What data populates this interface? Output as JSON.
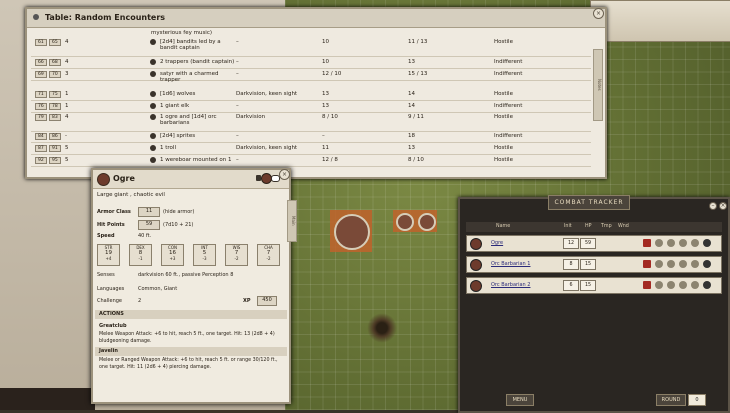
{
  "encounters": {
    "title": "Table: Random Encounters",
    "top_text": "mysterious fey music)",
    "rows": [
      {
        "from": "61",
        "to": "65",
        "count": "4",
        "name": "[2d4] bandits led by a bandit captain",
        "senses": "–",
        "col3": "10",
        "col4": "11 / 13",
        "att": "Hostile"
      },
      {
        "from": "66",
        "to": "68",
        "count": "4",
        "name": "2 trappers (bandit captain)",
        "senses": "–",
        "col3": "10",
        "col4": "13",
        "att": "Indifferent"
      },
      {
        "from": "69",
        "to": "70",
        "count": "3",
        "name": "satyr with a charmed trapper",
        "senses": "–",
        "col3": "12 / 10",
        "col4": "15 / 13",
        "att": "Indifferent"
      },
      {
        "from": "71",
        "to": "75",
        "count": "1",
        "name": "[1d6] wolves",
        "senses": "Darkvision, keen sight",
        "col3": "13",
        "col4": "14",
        "att": "Hostile"
      },
      {
        "from": "76",
        "to": "78",
        "count": "1",
        "name": "1 giant elk",
        "senses": "–",
        "col3": "13",
        "col4": "14",
        "att": "Indifferent"
      },
      {
        "from": "79",
        "to": "83",
        "count": "4",
        "name": "1 ogre and [1d4] orc barbarians",
        "senses": "Darkvision",
        "col3": "8 / 10",
        "col4": "9 / 11",
        "att": "Hostile"
      },
      {
        "from": "84",
        "to": "86",
        "count": "-",
        "name": "[2d4] sprites",
        "senses": "–",
        "col3": "–",
        "col4": "18",
        "att": "Indifferent"
      },
      {
        "from": "87",
        "to": "91",
        "count": "5",
        "name": "1 troll",
        "senses": "Darkvision, keen sight",
        "col3": "11",
        "col4": "13",
        "att": "Hostile"
      },
      {
        "from": "92",
        "to": "95",
        "count": "5",
        "name": "1 wereboar mounted on 1",
        "senses": "–",
        "col3": "12 / 8",
        "col4": "8 / 10",
        "att": "Hostile"
      }
    ],
    "side_tab": "Notes"
  },
  "ogre": {
    "name": "Ogre",
    "type": "Large giant , chaotic evil",
    "ac_label": "Armor Class",
    "ac": "11",
    "ac_note": "(hide armor)",
    "hp_label": "Hit Points",
    "hp": "59",
    "hp_note": "(7d10 + 21)",
    "speed_label": "Speed",
    "speed": "40 ft.",
    "abilities": [
      {
        "n": "STR",
        "v": "19",
        "m": "+4"
      },
      {
        "n": "DEX",
        "v": "8",
        "m": "-1"
      },
      {
        "n": "CON",
        "v": "16",
        "m": "+3"
      },
      {
        "n": "INT",
        "v": "5",
        "m": "-3"
      },
      {
        "n": "WIS",
        "v": "7",
        "m": "-2"
      },
      {
        "n": "CHA",
        "v": "7",
        "m": "-2"
      }
    ],
    "senses_label": "Senses",
    "senses": "darkvision 60 ft., passive Perception 8",
    "lang_label": "Languages",
    "lang": "Common, Giant",
    "cr_label": "Challenge",
    "cr": "2",
    "xp_label": "XP",
    "xp": "450",
    "actions_label": "ACTIONS",
    "greatclub_label": "Greatclub",
    "greatclub_text": "Melee Weapon Attack: +6 to hit, reach 5 ft., one target. Hit: 13 (2d8 + 4) bludgeoning damage.",
    "javelin_label": "Javelin",
    "javelin_text": "Melee or Ranged Weapon Attack: +6 to hit, reach 5 ft. or range 30/120 ft., one target. Hit: 11 (2d6 + 4) piercing damage.",
    "side_tab": "Main"
  },
  "tracker": {
    "title": "COMBAT TRACKER",
    "headers": {
      "name": "Name",
      "init": "Init",
      "hp": "HP",
      "tmp": "Tmp",
      "wnd": "Wnd"
    },
    "rows": [
      {
        "name": "Ogre",
        "init": "12",
        "hp": "59"
      },
      {
        "name": "Orc Barbarian 1",
        "init": "8",
        "hp": "15"
      },
      {
        "name": "Orc Barbarian 2",
        "init": "6",
        "hp": "15"
      }
    ],
    "menu_label": "MENU",
    "round_label": "ROUND",
    "round_value": "0"
  }
}
